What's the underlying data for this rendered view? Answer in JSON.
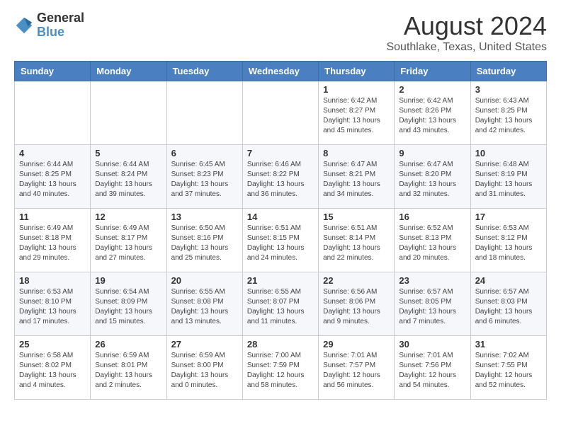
{
  "logo": {
    "general": "General",
    "blue": "Blue"
  },
  "title": "August 2024",
  "location": "Southlake, Texas, United States",
  "days_of_week": [
    "Sunday",
    "Monday",
    "Tuesday",
    "Wednesday",
    "Thursday",
    "Friday",
    "Saturday"
  ],
  "weeks": [
    [
      {
        "day": "",
        "info": ""
      },
      {
        "day": "",
        "info": ""
      },
      {
        "day": "",
        "info": ""
      },
      {
        "day": "",
        "info": ""
      },
      {
        "day": "1",
        "info": "Sunrise: 6:42 AM\nSunset: 8:27 PM\nDaylight: 13 hours\nand 45 minutes."
      },
      {
        "day": "2",
        "info": "Sunrise: 6:42 AM\nSunset: 8:26 PM\nDaylight: 13 hours\nand 43 minutes."
      },
      {
        "day": "3",
        "info": "Sunrise: 6:43 AM\nSunset: 8:25 PM\nDaylight: 13 hours\nand 42 minutes."
      }
    ],
    [
      {
        "day": "4",
        "info": "Sunrise: 6:44 AM\nSunset: 8:25 PM\nDaylight: 13 hours\nand 40 minutes."
      },
      {
        "day": "5",
        "info": "Sunrise: 6:44 AM\nSunset: 8:24 PM\nDaylight: 13 hours\nand 39 minutes."
      },
      {
        "day": "6",
        "info": "Sunrise: 6:45 AM\nSunset: 8:23 PM\nDaylight: 13 hours\nand 37 minutes."
      },
      {
        "day": "7",
        "info": "Sunrise: 6:46 AM\nSunset: 8:22 PM\nDaylight: 13 hours\nand 36 minutes."
      },
      {
        "day": "8",
        "info": "Sunrise: 6:47 AM\nSunset: 8:21 PM\nDaylight: 13 hours\nand 34 minutes."
      },
      {
        "day": "9",
        "info": "Sunrise: 6:47 AM\nSunset: 8:20 PM\nDaylight: 13 hours\nand 32 minutes."
      },
      {
        "day": "10",
        "info": "Sunrise: 6:48 AM\nSunset: 8:19 PM\nDaylight: 13 hours\nand 31 minutes."
      }
    ],
    [
      {
        "day": "11",
        "info": "Sunrise: 6:49 AM\nSunset: 8:18 PM\nDaylight: 13 hours\nand 29 minutes."
      },
      {
        "day": "12",
        "info": "Sunrise: 6:49 AM\nSunset: 8:17 PM\nDaylight: 13 hours\nand 27 minutes."
      },
      {
        "day": "13",
        "info": "Sunrise: 6:50 AM\nSunset: 8:16 PM\nDaylight: 13 hours\nand 25 minutes."
      },
      {
        "day": "14",
        "info": "Sunrise: 6:51 AM\nSunset: 8:15 PM\nDaylight: 13 hours\nand 24 minutes."
      },
      {
        "day": "15",
        "info": "Sunrise: 6:51 AM\nSunset: 8:14 PM\nDaylight: 13 hours\nand 22 minutes."
      },
      {
        "day": "16",
        "info": "Sunrise: 6:52 AM\nSunset: 8:13 PM\nDaylight: 13 hours\nand 20 minutes."
      },
      {
        "day": "17",
        "info": "Sunrise: 6:53 AM\nSunset: 8:12 PM\nDaylight: 13 hours\nand 18 minutes."
      }
    ],
    [
      {
        "day": "18",
        "info": "Sunrise: 6:53 AM\nSunset: 8:10 PM\nDaylight: 13 hours\nand 17 minutes."
      },
      {
        "day": "19",
        "info": "Sunrise: 6:54 AM\nSunset: 8:09 PM\nDaylight: 13 hours\nand 15 minutes."
      },
      {
        "day": "20",
        "info": "Sunrise: 6:55 AM\nSunset: 8:08 PM\nDaylight: 13 hours\nand 13 minutes."
      },
      {
        "day": "21",
        "info": "Sunrise: 6:55 AM\nSunset: 8:07 PM\nDaylight: 13 hours\nand 11 minutes."
      },
      {
        "day": "22",
        "info": "Sunrise: 6:56 AM\nSunset: 8:06 PM\nDaylight: 13 hours\nand 9 minutes."
      },
      {
        "day": "23",
        "info": "Sunrise: 6:57 AM\nSunset: 8:05 PM\nDaylight: 13 hours\nand 7 minutes."
      },
      {
        "day": "24",
        "info": "Sunrise: 6:57 AM\nSunset: 8:03 PM\nDaylight: 13 hours\nand 6 minutes."
      }
    ],
    [
      {
        "day": "25",
        "info": "Sunrise: 6:58 AM\nSunset: 8:02 PM\nDaylight: 13 hours\nand 4 minutes."
      },
      {
        "day": "26",
        "info": "Sunrise: 6:59 AM\nSunset: 8:01 PM\nDaylight: 13 hours\nand 2 minutes."
      },
      {
        "day": "27",
        "info": "Sunrise: 6:59 AM\nSunset: 8:00 PM\nDaylight: 13 hours\nand 0 minutes."
      },
      {
        "day": "28",
        "info": "Sunrise: 7:00 AM\nSunset: 7:59 PM\nDaylight: 12 hours\nand 58 minutes."
      },
      {
        "day": "29",
        "info": "Sunrise: 7:01 AM\nSunset: 7:57 PM\nDaylight: 12 hours\nand 56 minutes."
      },
      {
        "day": "30",
        "info": "Sunrise: 7:01 AM\nSunset: 7:56 PM\nDaylight: 12 hours\nand 54 minutes."
      },
      {
        "day": "31",
        "info": "Sunrise: 7:02 AM\nSunset: 7:55 PM\nDaylight: 12 hours\nand 52 minutes."
      }
    ]
  ]
}
